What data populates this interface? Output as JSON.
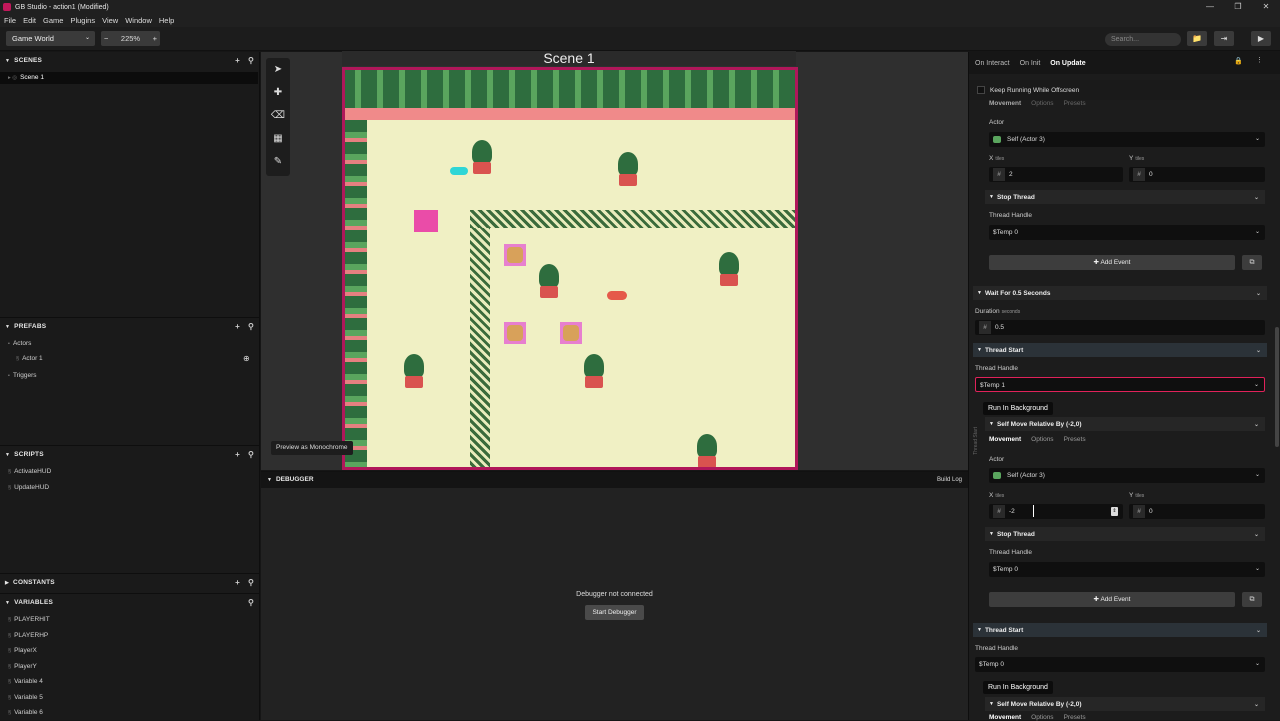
{
  "window": {
    "title": "GB Studio - action1 (Modified)",
    "min": "—",
    "max": "❐",
    "close": "✕"
  },
  "menu": [
    "File",
    "Edit",
    "Game",
    "Plugins",
    "View",
    "Window",
    "Help"
  ],
  "toolbar": {
    "view_select": "Game World",
    "zoom_minus": "−",
    "zoom_level": "225%",
    "zoom_plus": "+",
    "search_placeholder": "Search...",
    "open_folder": "📁",
    "export": "⇥",
    "play": "▶"
  },
  "sidebar": {
    "scenes": {
      "title": "SCENES",
      "items": [
        "Scene 1"
      ]
    },
    "prefabs": {
      "title": "PREFABS",
      "groups": [
        {
          "label": "Actors",
          "items": [
            "Actor 1"
          ]
        },
        {
          "label": "Triggers",
          "items": []
        }
      ]
    },
    "scripts": {
      "title": "SCRIPTS",
      "items": [
        "ActivateHUD",
        "UpdateHUD"
      ]
    },
    "constants": {
      "title": "CONSTANTS"
    },
    "variables": {
      "title": "VARIABLES",
      "items": [
        "PLAYERHIT",
        "PLAYERHP",
        "PlayerX",
        "PlayerY",
        "Variable 4",
        "Variable 5",
        "Variable 6"
      ]
    }
  },
  "canvas": {
    "scene_title": "Scene 1",
    "preview_mono": "Preview as Monochrome",
    "tools": [
      "select",
      "add",
      "eraser",
      "collisions",
      "colors"
    ]
  },
  "debugger": {
    "title": "DEBUGGER",
    "build_log": "Build Log",
    "status": "Debugger not connected",
    "start_button": "Start Debugger"
  },
  "right_panel": {
    "tabs": [
      "On Interact",
      "On Init",
      "On Update"
    ],
    "active_tab": "On Update",
    "keep_running": "Keep Running While Offscreen",
    "subtabs_cut": [
      "Movement",
      "Options",
      "Presets"
    ],
    "block1": {
      "actor_label": "Actor",
      "actor_value": "Self (Actor 3)",
      "x_label": "X",
      "x_units": "tiles",
      "x_value": "2",
      "y_label": "Y",
      "y_units": "tiles",
      "y_value": "0",
      "stop_thread": {
        "title": "Stop Thread",
        "handle_label": "Thread Handle",
        "handle_value": "$Temp 0"
      },
      "add_event": "Add Event"
    },
    "wait": {
      "title": "Wait For 0.5 Seconds",
      "duration_label": "Duration",
      "duration_units": "seconds",
      "duration_value": "0.5"
    },
    "thread_start_1": {
      "title": "Thread Start",
      "handle_label": "Thread Handle",
      "handle_value": "$Temp 1",
      "run_bg": "Run In Background",
      "move": {
        "title": "Self Move Relative By (-2,0)",
        "tabs": [
          "Movement",
          "Options",
          "Presets"
        ],
        "actor_label": "Actor",
        "actor_value": "Self (Actor 3)",
        "x_label": "X",
        "x_units": "tiles",
        "x_value": "-2",
        "y_label": "Y",
        "y_units": "tiles",
        "y_value": "0"
      },
      "stop_thread": {
        "title": "Stop Thread",
        "handle_label": "Thread Handle",
        "handle_value": "$Temp 0"
      },
      "add_event": "Add Event"
    },
    "thread_start_2": {
      "title": "Thread Start",
      "handle_label": "Thread Handle",
      "handle_value": "$Temp 0",
      "run_bg": "Run In Background",
      "move": {
        "title": "Self Move Relative By (-2,0)",
        "tabs": [
          "Movement",
          "Options",
          "Presets"
        ]
      }
    },
    "side_label": "Thread Start"
  },
  "colors": {
    "accent": "#b0175a",
    "highlight_border": "#e0225a",
    "bg": "#1c1c1c"
  }
}
